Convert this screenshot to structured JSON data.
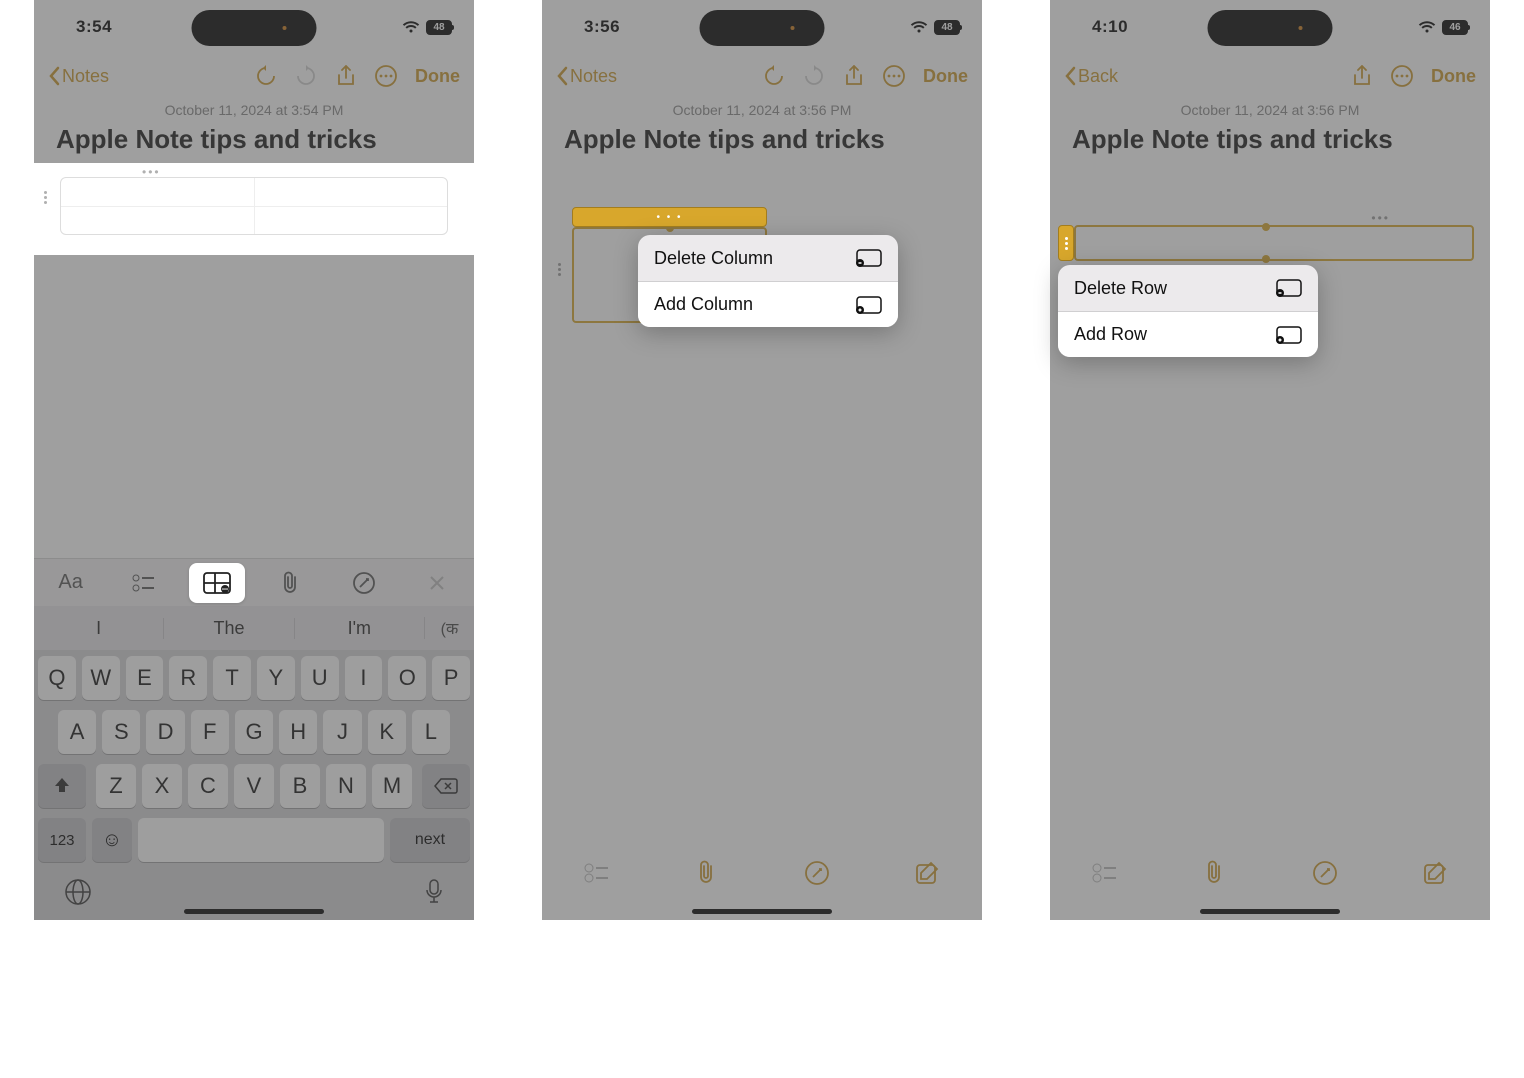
{
  "panel1": {
    "status": {
      "time": "3:54",
      "battery": "48"
    },
    "nav": {
      "back": "Notes",
      "done": "Done"
    },
    "date": "October 11, 2024 at 3:54 PM",
    "title": "Apple Note tips and tricks",
    "suggestions": {
      "left": "I",
      "mid": "The",
      "right": "I'm",
      "lang": "(क"
    },
    "keyboard": {
      "r1": [
        "Q",
        "W",
        "E",
        "R",
        "T",
        "Y",
        "U",
        "I",
        "O",
        "P"
      ],
      "r2": [
        "A",
        "S",
        "D",
        "F",
        "G",
        "H",
        "J",
        "K",
        "L"
      ],
      "r3": [
        "Z",
        "X",
        "C",
        "V",
        "B",
        "N",
        "M"
      ],
      "k123": "123",
      "next": "next"
    }
  },
  "panel2": {
    "status": {
      "time": "3:56",
      "battery": "48"
    },
    "nav": {
      "back": "Notes",
      "done": "Done"
    },
    "date": "October 11, 2024 at 3:56 PM",
    "title": "Apple Note tips and tricks",
    "menu": {
      "delete": "Delete Column",
      "add": "Add Column"
    }
  },
  "panel3": {
    "status": {
      "time": "4:10",
      "battery": "46"
    },
    "nav": {
      "back": "Back",
      "done": "Done"
    },
    "date": "October 11, 2024 at 3:56 PM",
    "title": "Apple Note tips and tricks",
    "menu": {
      "delete": "Delete Row",
      "add": "Add Row"
    }
  }
}
